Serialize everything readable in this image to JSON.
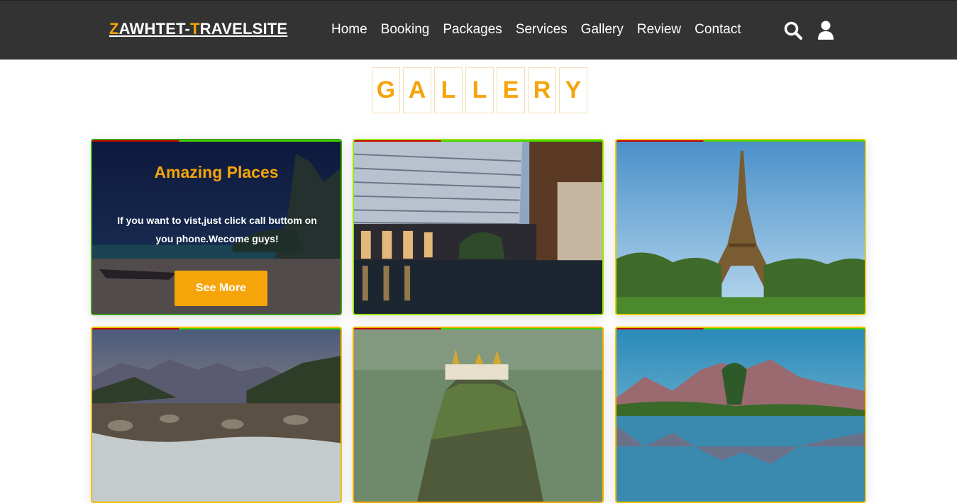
{
  "navbar": {
    "logo_first": "Z",
    "logo_mid": "AWHTET-",
    "logo_second": "T",
    "logo_rest": "RAVELSITE",
    "links": [
      "Home",
      "Booking",
      "Packages",
      "Services",
      "Gallery",
      "Review",
      "Contact"
    ],
    "icons": [
      "search-icon",
      "user-icon"
    ]
  },
  "gallery": {
    "title_letters": [
      "G",
      "A",
      "L",
      "L",
      "E",
      "R",
      "Y"
    ]
  },
  "featured": {
    "title": "Amazing Places",
    "text": "If you want to vist,just click call buttom on you phone.Wecome guys!",
    "button": "See More"
  },
  "colors": {
    "accent": "#f5a40a",
    "nav_bg": "#333333"
  }
}
